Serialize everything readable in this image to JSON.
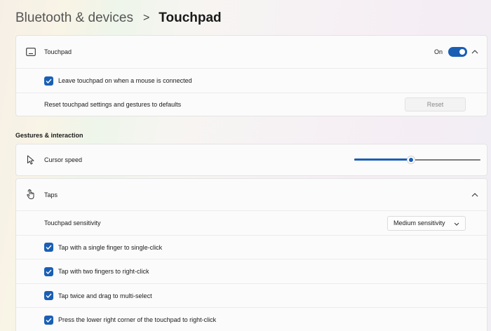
{
  "breadcrumb": {
    "parent": "Bluetooth & devices",
    "separator": ">",
    "current": "Touchpad"
  },
  "touchpad_card": {
    "header": {
      "label": "Touchpad",
      "icon": "touchpad-icon",
      "toggle_state": "On",
      "toggle_on": true
    },
    "leave_on": {
      "label": "Leave touchpad on when a mouse is connected",
      "checked": true
    },
    "reset_row": {
      "label": "Reset touchpad settings and gestures to defaults",
      "button_label": "Reset"
    }
  },
  "gestures_section": {
    "title": "Gestures & interaction"
  },
  "cursor_speed": {
    "label": "Cursor speed",
    "icon": "cursor-icon",
    "value_fraction": 0.45
  },
  "taps": {
    "label": "Taps",
    "icon": "tap-hand-icon",
    "sensitivity": {
      "label": "Touchpad sensitivity",
      "selected": "Medium sensitivity"
    },
    "options": [
      {
        "label": "Tap with a single finger to single-click",
        "checked": true
      },
      {
        "label": "Tap with two fingers to right-click",
        "checked": true
      },
      {
        "label": "Tap twice and drag to multi-select",
        "checked": true
      },
      {
        "label": "Press the lower right corner of the touchpad to right-click",
        "checked": true
      }
    ]
  },
  "colors": {
    "accent": "#1a5fb4"
  }
}
